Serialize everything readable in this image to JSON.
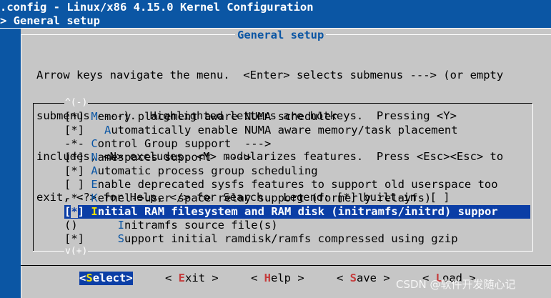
{
  "header": {
    "title": ".config - Linux/x86 4.15.0 Kernel Configuration",
    "path": "> General setup"
  },
  "dialog": {
    "title": "General setup",
    "help_lines": [
      "Arrow keys navigate the menu.  <Enter> selects submenus ---> (or empty",
      "submenus ----).  Highlighted letters are hotkeys.  Pressing <Y>",
      "includes, <N> excludes, <M> modularizes features.  Press <Esc><Esc> to",
      "exit, <?> for Help, </> for Search.  Legend: [*] built-in  [ ]"
    ],
    "scroll_up": "^(-)",
    "scroll_down": "v(+)",
    "items": [
      {
        "prefix": "[*] ",
        "indent": "",
        "hotkey": "M",
        "rest": "emory placement aware NUMA scheduler"
      },
      {
        "prefix": "[*]   ",
        "indent": "",
        "hotkey": "A",
        "rest": "utomatically enable NUMA aware memory/task placement"
      },
      {
        "prefix": "-*- ",
        "indent": "",
        "hotkey": "C",
        "rest": "ontrol Group support  --->"
      },
      {
        "prefix": "[*] ",
        "indent": "",
        "hotkey": "N",
        "rest": "amespaces support  --->"
      },
      {
        "prefix": "[*] ",
        "indent": "",
        "hotkey": "A",
        "rest": "utomatic process group scheduling"
      },
      {
        "prefix": "[ ] ",
        "indent": "",
        "hotkey": "E",
        "rest": "nable deprecated sysfs features to support old userspace too"
      },
      {
        "prefix": "-*- ",
        "indent": "",
        "hotkey": "K",
        "rest": "ernel->user space relay support (formerly relayfs)"
      },
      {
        "prefix_open": "[",
        "prefix_cursor": "*",
        "prefix_close": "] ",
        "hotkey": "I",
        "rest": "nitial RAM filesystem and RAM disk (initramfs/initrd) suppor",
        "selected": true
      },
      {
        "prefix": "()      ",
        "indent": "",
        "hotkey": "I",
        "rest": "nitramfs source file(s)"
      },
      {
        "prefix": "[*]     ",
        "indent": "",
        "hotkey": "S",
        "rest": "upport initial ramdisk/ramfs compressed using gzip"
      }
    ],
    "buttons": [
      {
        "pre": "<",
        "hotkey": "S",
        "rest": "elect>",
        "selected": true
      },
      {
        "pre": "< ",
        "hotkey": "E",
        "rest": "xit >"
      },
      {
        "pre": "< ",
        "hotkey": "H",
        "rest": "elp >"
      },
      {
        "pre": "< ",
        "hotkey": "S",
        "rest": "ave >"
      },
      {
        "pre": "< ",
        "hotkey": "L",
        "rest": "oad >"
      }
    ]
  },
  "watermark": "CSDN @软件开发随心记"
}
